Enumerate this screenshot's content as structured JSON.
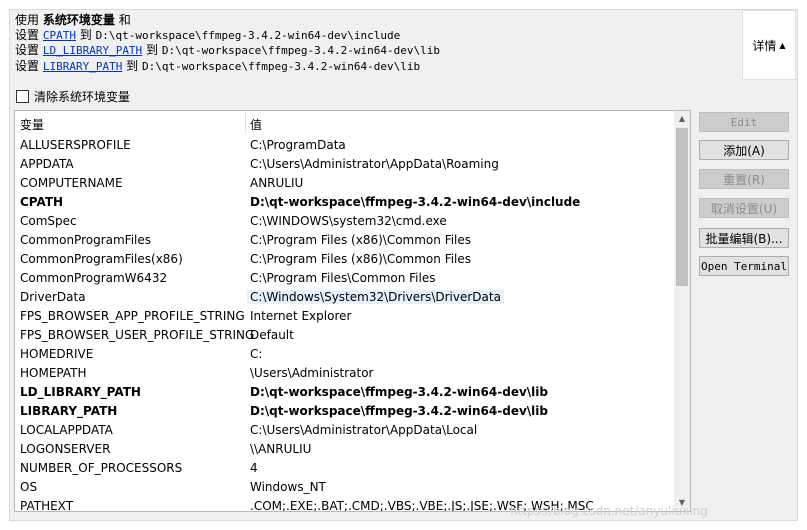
{
  "summary": {
    "line1_prefix": "使用",
    "line1_bold": "系统环境变量",
    "line1_suffix": "和",
    "line2_prefix": "设置",
    "line2_var": "CPATH",
    "line2_to": "到",
    "line2_path": "D:\\qt-workspace\\ffmpeg-3.4.2-win64-dev\\include",
    "line3_prefix": "设置",
    "line3_var": "LD_LIBRARY_PATH",
    "line3_to": "到",
    "line3_path": "D:\\qt-workspace\\ffmpeg-3.4.2-win64-dev\\lib",
    "line4_prefix": "设置",
    "line4_var": "LIBRARY_PATH",
    "line4_to": "到",
    "line4_path": "D:\\qt-workspace\\ffmpeg-3.4.2-win64-dev\\lib"
  },
  "details_button": {
    "label": "详情",
    "icon": "triangle-up-icon"
  },
  "clear_checkbox": {
    "label": "清除系统环境变量",
    "checked": false
  },
  "table": {
    "headers": [
      "变量",
      "值"
    ],
    "rows": [
      {
        "name": "ALLUSERSPROFILE",
        "value": "C:\\ProgramData",
        "bold": false,
        "selected": false
      },
      {
        "name": "APPDATA",
        "value": "C:\\Users\\Administrator\\AppData\\Roaming",
        "bold": false,
        "selected": false
      },
      {
        "name": "COMPUTERNAME",
        "value": "ANRULIU",
        "bold": false,
        "selected": false
      },
      {
        "name": "CPATH",
        "value": "D:\\qt-workspace\\ffmpeg-3.4.2-win64-dev\\include",
        "bold": true,
        "selected": false
      },
      {
        "name": "ComSpec",
        "value": "C:\\WINDOWS\\system32\\cmd.exe",
        "bold": false,
        "selected": false
      },
      {
        "name": "CommonProgramFiles",
        "value": "C:\\Program Files (x86)\\Common Files",
        "bold": false,
        "selected": false
      },
      {
        "name": "CommonProgramFiles(x86)",
        "value": "C:\\Program Files (x86)\\Common Files",
        "bold": false,
        "selected": false
      },
      {
        "name": "CommonProgramW6432",
        "value": "C:\\Program Files\\Common Files",
        "bold": false,
        "selected": false
      },
      {
        "name": "DriverData",
        "value": "C:\\Windows\\System32\\Drivers\\DriverData",
        "bold": false,
        "selected": true
      },
      {
        "name": "FPS_BROWSER_APP_PROFILE_STRING",
        "value": "Internet Explorer",
        "bold": false,
        "selected": false
      },
      {
        "name": "FPS_BROWSER_USER_PROFILE_STRING",
        "value": "Default",
        "bold": false,
        "selected": false
      },
      {
        "name": "HOMEDRIVE",
        "value": "C:",
        "bold": false,
        "selected": false
      },
      {
        "name": "HOMEPATH",
        "value": "\\Users\\Administrator",
        "bold": false,
        "selected": false
      },
      {
        "name": "LD_LIBRARY_PATH",
        "value": "D:\\qt-workspace\\ffmpeg-3.4.2-win64-dev\\lib",
        "bold": true,
        "selected": false
      },
      {
        "name": "LIBRARY_PATH",
        "value": "D:\\qt-workspace\\ffmpeg-3.4.2-win64-dev\\lib",
        "bold": true,
        "selected": false
      },
      {
        "name": "LOCALAPPDATA",
        "value": "C:\\Users\\Administrator\\AppData\\Local",
        "bold": false,
        "selected": false
      },
      {
        "name": "LOGONSERVER",
        "value": "\\\\ANRULIU",
        "bold": false,
        "selected": false
      },
      {
        "name": "NUMBER_OF_PROCESSORS",
        "value": "4",
        "bold": false,
        "selected": false
      },
      {
        "name": "OS",
        "value": "Windows_NT",
        "bold": false,
        "selected": false
      },
      {
        "name": "PATHEXT",
        "value": ".COM;.EXE;.BAT;.CMD;.VBS;.VBE;.JS;.JSE;.WSF;.WSH;.MSC",
        "bold": false,
        "selected": false
      }
    ]
  },
  "buttons": [
    {
      "label": "Edit",
      "name": "edit-button",
      "disabled": true,
      "mono": true
    },
    {
      "label": "添加(A)",
      "name": "add-button",
      "disabled": false,
      "mono": false
    },
    {
      "label": "重置(R)",
      "name": "reset-button",
      "disabled": true,
      "mono": false
    },
    {
      "label": "取消设置(U)",
      "name": "unset-button",
      "disabled": true,
      "mono": false
    },
    {
      "label": "批量编辑(B)...",
      "name": "batch-edit-button",
      "disabled": false,
      "mono": false
    },
    {
      "label": "Open Terminal",
      "name": "open-terminal-button",
      "disabled": false,
      "mono": true
    }
  ],
  "watermark": "https://blog.csdn.net/anyuliuxing"
}
